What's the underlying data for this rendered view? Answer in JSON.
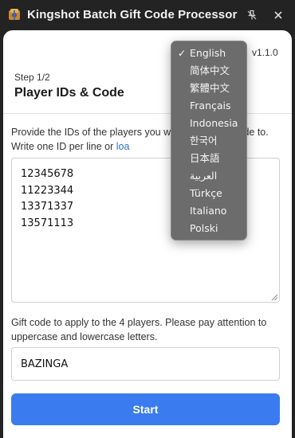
{
  "titlebar": {
    "title": "Kingshot Batch Gift Code Processor",
    "pin_icon": "unpin-icon",
    "close_icon": "close-icon"
  },
  "header": {
    "version": "v1.1.0",
    "step": "Step 1/2",
    "heading": "Player IDs & Code"
  },
  "language": {
    "selected": "English",
    "options": [
      "English",
      "简体中文",
      "繁體中文",
      "Français",
      "Indonesia",
      "한국어",
      "日本語",
      "العربية",
      "Türkçe",
      "Italiano",
      "Polski"
    ]
  },
  "ids_section": {
    "description_start": "Provide the IDs of the players you w",
    "description_end": "gift code to. Write one ID per line or ",
    "link_text": "loa",
    "description_tail": ".",
    "value": "12345678\n11223344\n13371337\n13571113"
  },
  "code_section": {
    "label": "Gift code to apply to the 4 players. Please pay attention to uppercase and lowercase letters.",
    "value": "BAZINGA"
  },
  "actions": {
    "start_label": "Start"
  },
  "colors": {
    "accent": "#3b7bf0",
    "link": "#2f6fde",
    "titlebar_bg": "#232323",
    "menu_bg": "#6c6c6c"
  }
}
